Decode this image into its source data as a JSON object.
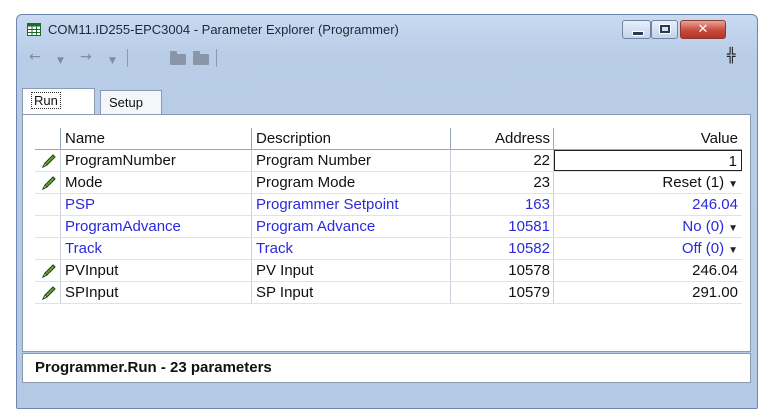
{
  "window": {
    "title": "COM11.ID255-EPC3004 - Parameter Explorer (Programmer)",
    "close_glyph": "✕"
  },
  "toolbar": {
    "icons": [
      "back-arrow-icon",
      "back-dropdown-icon",
      "forward-arrow-icon",
      "forward-dropdown-icon",
      "folder-icon",
      "folder-open-icon",
      "pin-icon"
    ]
  },
  "tabs": [
    {
      "label": "Run",
      "active": true
    },
    {
      "label": "Setup",
      "active": false
    }
  ],
  "table": {
    "headers": {
      "name": "Name",
      "description": "Description",
      "address": "Address",
      "value": "Value"
    },
    "rows": [
      {
        "name": "ProgramNumber",
        "description": "Program Number",
        "address": "22",
        "value": "1",
        "editable": true,
        "color": "black",
        "dropdown": false
      },
      {
        "name": "Mode",
        "description": "Program Mode",
        "address": "23",
        "value": "Reset (1)",
        "editable": true,
        "color": "black",
        "dropdown": true
      },
      {
        "name": "PSP",
        "description": "Programmer Setpoint",
        "address": "163",
        "value": "246.04",
        "editable": false,
        "color": "blue",
        "dropdown": false
      },
      {
        "name": "ProgramAdvance",
        "description": "Program Advance",
        "address": "10581",
        "value": "No (0)",
        "editable": false,
        "color": "blue",
        "dropdown": true
      },
      {
        "name": "Track",
        "description": "Track",
        "address": "10582",
        "value": "Off (0)",
        "editable": false,
        "color": "blue",
        "dropdown": true
      },
      {
        "name": "PVInput",
        "description": "PV Input",
        "address": "10578",
        "value": "246.04",
        "editable": true,
        "color": "black",
        "dropdown": false
      },
      {
        "name": "SPInput",
        "description": "SP Input",
        "address": "10579",
        "value": "291.00",
        "editable": true,
        "color": "black",
        "dropdown": false
      }
    ]
  },
  "status": {
    "text": "Programmer.Run  -  23 parameters"
  },
  "colors": {
    "blue_text": "#2a2adc",
    "titlebar": "#c9daf0"
  }
}
